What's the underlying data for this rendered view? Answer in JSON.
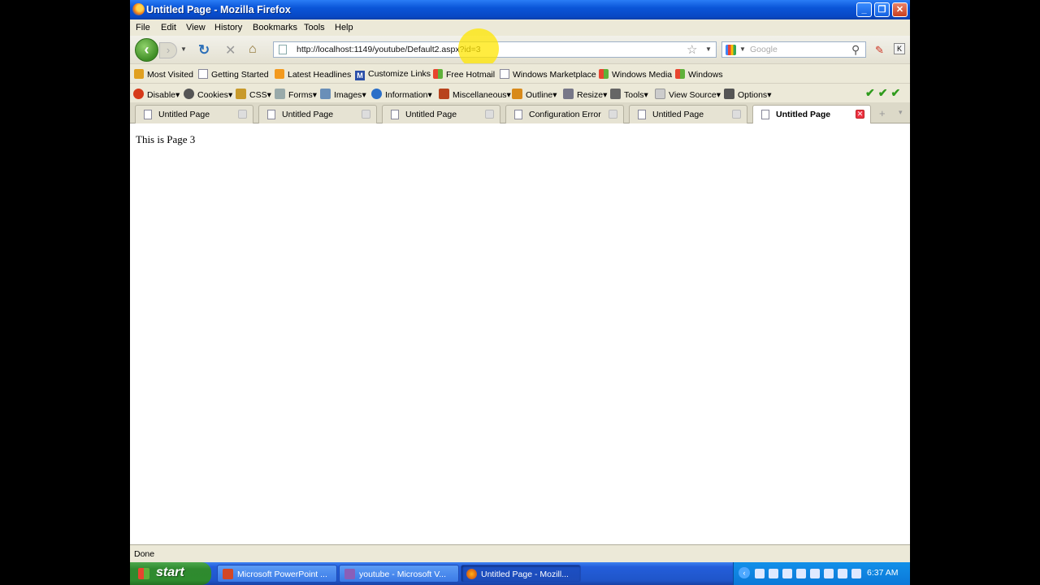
{
  "window": {
    "title": "Untitled Page - Mozilla Firefox"
  },
  "menu": [
    "File",
    "Edit",
    "View",
    "History",
    "Bookmarks",
    "Tools",
    "Help"
  ],
  "address": {
    "url": "http://localhost:1149/youtube/Default2.aspx?id=3"
  },
  "search": {
    "placeholder": "Google"
  },
  "bookmarks": [
    "Most Visited",
    "Getting Started",
    "Latest Headlines",
    "Customize Links",
    "Free Hotmail",
    "Windows Marketplace",
    "Windows Media",
    "Windows"
  ],
  "devtoolbar": [
    "Disable",
    "Cookies",
    "CSS",
    "Forms",
    "Images",
    "Information",
    "Miscellaneous",
    "Outline",
    "Resize",
    "Tools",
    "View Source",
    "Options"
  ],
  "tabs": [
    {
      "label": "Untitled Page",
      "active": false
    },
    {
      "label": "Untitled Page",
      "active": false
    },
    {
      "label": "Untitled Page",
      "active": false
    },
    {
      "label": "Configuration Error",
      "active": false
    },
    {
      "label": "Untitled Page",
      "active": false
    },
    {
      "label": "Untitled Page",
      "active": true
    }
  ],
  "content": {
    "text": "This is Page 3"
  },
  "status": {
    "text": "Done"
  },
  "taskbar": {
    "start": "start",
    "items": [
      {
        "label": "Microsoft PowerPoint ...",
        "icon": "powerpoint-icon"
      },
      {
        "label": "youtube - Microsoft V...",
        "icon": "visual-studio-icon"
      },
      {
        "label": "Untitled Page - Mozill...",
        "icon": "firefox-icon"
      }
    ],
    "clock": "6:37 AM"
  },
  "colors": {
    "titlebar": "#0a55d8",
    "taskbar": "#245edb",
    "start": "#2f8a2f",
    "chrome": "#ece9d8"
  }
}
